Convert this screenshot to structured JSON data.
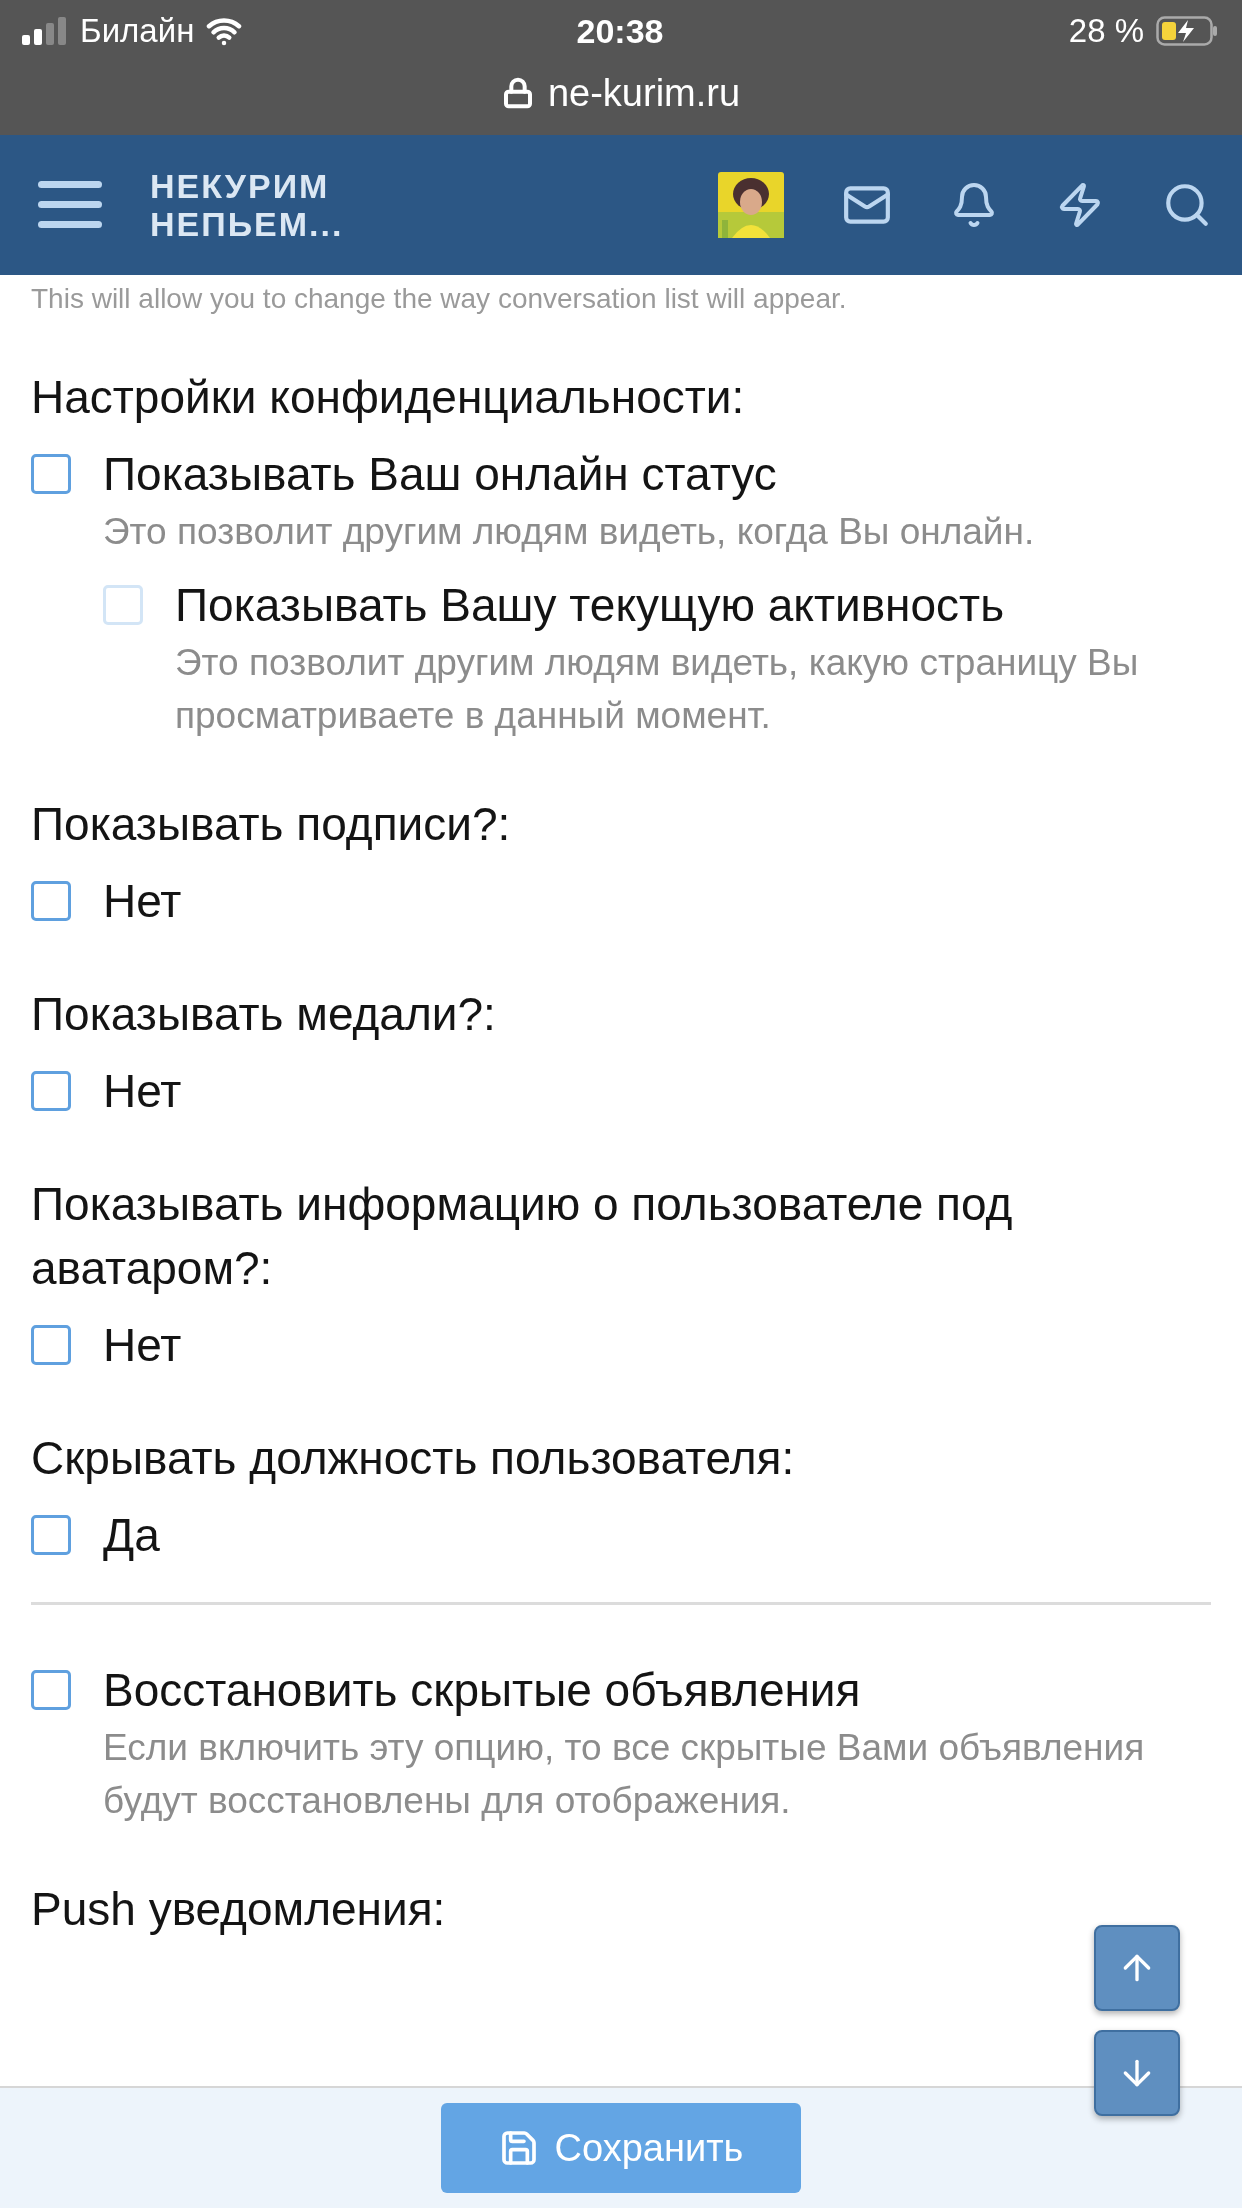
{
  "status_bar": {
    "carrier": "Билайн",
    "time": "20:38",
    "battery": "28 %"
  },
  "address_bar": {
    "url": "ne-kurim.ru"
  },
  "header": {
    "logo_lines": [
      "НЕКУРИМ",
      "НЕПЬЕМ..."
    ]
  },
  "intro_text": "This will allow you to change the way conversation list will appear.",
  "sections": [
    {
      "kind": "group",
      "title": "Настройки конфиденциальности:",
      "options": [
        {
          "label": "Показывать Ваш онлайн статус",
          "description": "Это позволит другим людям видеть, когда Вы онлайн.",
          "checked": false,
          "disabled": false,
          "children": [
            {
              "label": "Показывать Вашу текущую активность",
              "description": "Это позволит другим людям видеть, какую страницу Вы просматриваете в данный момент.",
              "checked": false,
              "disabled": true
            }
          ]
        }
      ]
    },
    {
      "kind": "group",
      "title": "Показывать подписи?:",
      "options": [
        {
          "label": "Нет",
          "checked": false,
          "disabled": false
        }
      ]
    },
    {
      "kind": "group",
      "title": "Показывать медали?:",
      "options": [
        {
          "label": "Нет",
          "checked": false,
          "disabled": false
        }
      ]
    },
    {
      "kind": "group",
      "title": "Показывать информацию о пользователе под аватаром?:",
      "options": [
        {
          "label": "Нет",
          "checked": false,
          "disabled": false
        }
      ]
    },
    {
      "kind": "group",
      "title": "Скрывать должность пользователя:",
      "options": [
        {
          "label": "Да",
          "checked": false,
          "disabled": false
        }
      ]
    },
    {
      "kind": "divider"
    },
    {
      "kind": "group",
      "options": [
        {
          "label": "Восстановить скрытые объявления",
          "description": "Если включить эту опцию, то все скрытые Вами объявления будут восстановлены для отображения.",
          "checked": false,
          "disabled": false
        }
      ]
    },
    {
      "kind": "group",
      "title": "Push уведомления:"
    }
  ],
  "save_button": {
    "label": "Сохранить"
  }
}
